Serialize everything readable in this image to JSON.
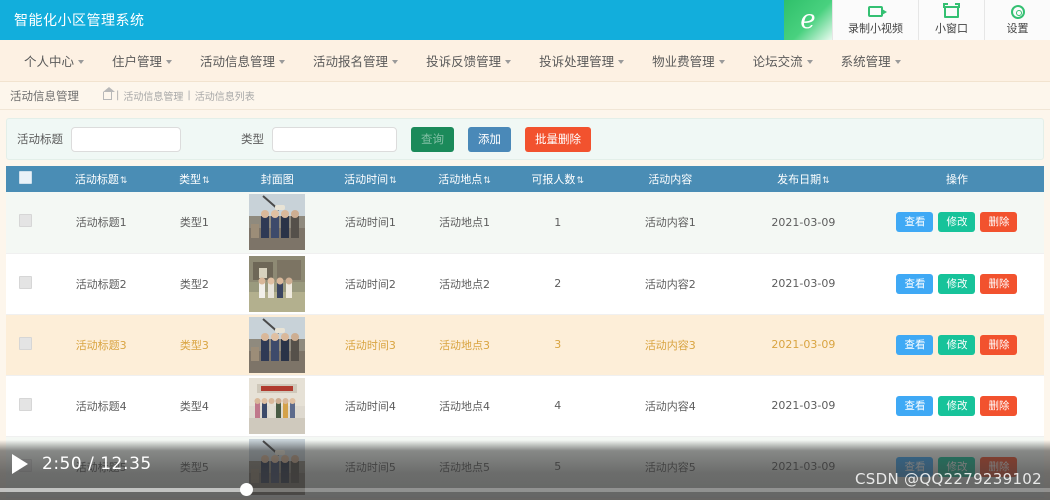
{
  "window": {
    "title": "智能化小区管理系统",
    "brand_color": "#12aedc",
    "tools": [
      {
        "name": "record-video",
        "label": "录制小视频",
        "icon": "camera-icon"
      },
      {
        "name": "small-window",
        "label": "小窗口",
        "icon": "window-icon"
      },
      {
        "name": "settings",
        "label": "设置",
        "icon": "gear-icon"
      }
    ],
    "logo_letter": "e"
  },
  "nav": {
    "items": [
      {
        "label": "个人中心"
      },
      {
        "label": "住户管理"
      },
      {
        "label": "活动信息管理"
      },
      {
        "label": "活动报名管理"
      },
      {
        "label": "投诉反馈管理"
      },
      {
        "label": "投诉处理管理"
      },
      {
        "label": "物业费管理"
      },
      {
        "label": "论坛交流"
      },
      {
        "label": "系统管理"
      }
    ]
  },
  "breadcrumb": {
    "section": "活动信息管理",
    "sep": "|",
    "path1": "活动信息管理",
    "path2": "活动信息列表"
  },
  "filter": {
    "title_label": "活动标题",
    "title_value": "",
    "title_placeholder": "",
    "type_label": "类型",
    "type_value": "",
    "type_placeholder": "",
    "search_label": "查询",
    "add_label": "添加",
    "batch_delete_label": "批量删除",
    "colors": {
      "search": "#1b8a5a",
      "add": "#4a89b8",
      "batch_delete": "#f2522e"
    }
  },
  "table": {
    "header_color": "#4a8db5",
    "sort_glyph": "⇅",
    "columns": [
      {
        "label": "",
        "sortable": false
      },
      {
        "label": "活动标题",
        "sortable": true
      },
      {
        "label": "类型",
        "sortable": true
      },
      {
        "label": "封面图",
        "sortable": false
      },
      {
        "label": "活动时间",
        "sortable": true
      },
      {
        "label": "活动地点",
        "sortable": true
      },
      {
        "label": "可报人数",
        "sortable": true
      },
      {
        "label": "活动内容",
        "sortable": false
      },
      {
        "label": "发布日期",
        "sortable": true
      },
      {
        "label": "操作",
        "sortable": false
      }
    ],
    "rows": [
      {
        "title": "活动标题1",
        "type": "类型1",
        "image": "outdoor-group-photo",
        "time": "活动时间1",
        "place": "活动地点1",
        "capacity": "1",
        "content": "活动内容1",
        "date": "2021-03-09"
      },
      {
        "title": "活动标题2",
        "type": "类型2",
        "image": "village-group-photo",
        "time": "活动时间2",
        "place": "活动地点2",
        "capacity": "2",
        "content": "活动内容2",
        "date": "2021-03-09"
      },
      {
        "title": "活动标题3",
        "type": "类型3",
        "image": "outdoor-group-photo",
        "time": "活动时间3",
        "place": "活动地点3",
        "capacity": "3",
        "content": "活动内容3",
        "date": "2021-03-09"
      },
      {
        "title": "活动标题4",
        "type": "类型4",
        "image": "indoor-group-photo",
        "time": "活动时间4",
        "place": "活动地点4",
        "capacity": "4",
        "content": "活动内容4",
        "date": "2021-03-09"
      },
      {
        "title": "活动标题5",
        "type": "类型5",
        "image": "outdoor-group-photo",
        "time": "活动时间5",
        "place": "活动地点5",
        "capacity": "5",
        "content": "活动内容5",
        "date": "2021-03-09"
      }
    ],
    "actions": {
      "view_label": "查看",
      "edit_label": "修改",
      "delete_label": "删除",
      "view_color": "#3fa9f5",
      "edit_color": "#17c39a",
      "delete_color": "#f2522e"
    }
  },
  "player": {
    "current_time": "2:50",
    "separator": "/",
    "total_time": "12:35",
    "time_display": "2:50 / 12:35",
    "state": "paused",
    "watermark": "CSDN @QQ2279239102"
  }
}
